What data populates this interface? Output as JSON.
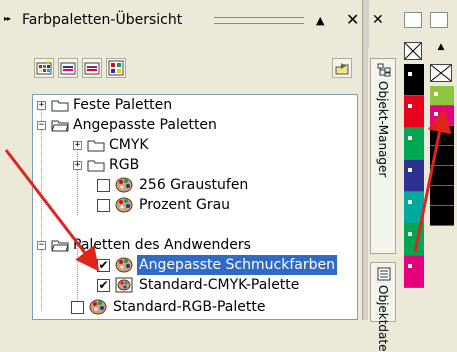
{
  "docker": {
    "title": "Farbpaletten-Übersicht",
    "collapse_symbol": "▸▸",
    "up_symbol": "▲",
    "close_symbol": "✕"
  },
  "toolbar": {
    "icons": [
      "new-palette-icon",
      "open-palette-icon",
      "palette-editor-icon",
      "palette-properties-icon",
      "import-icon"
    ]
  },
  "tree": {
    "items": [
      {
        "label": "Feste Paletten",
        "expander": "+",
        "icon": "folder-icon"
      },
      {
        "label": "Angepasste Paletten",
        "expander": "−",
        "icon": "folder-open-icon"
      },
      {
        "label": "CMYK",
        "expander": "+",
        "icon": "folder-icon"
      },
      {
        "label": "RGB",
        "expander": "+",
        "icon": "folder-icon"
      },
      {
        "label": "256 Graustufen",
        "checked": false,
        "icon": "palette-icon"
      },
      {
        "label": "Prozent Grau",
        "checked": false,
        "icon": "palette-icon"
      },
      {
        "label": "Paletten des Andwenders",
        "expander": "−",
        "icon": "folder-open-icon"
      },
      {
        "label": "Angepasste Schmuckfarben",
        "checked": true,
        "icon": "palette-icon",
        "selected": true
      },
      {
        "label": "Standard-CMYK-Palette",
        "checked": true,
        "icon": "palette-icon"
      },
      {
        "label": "Standard-RGB-Palette",
        "checked": false,
        "icon": "palette-icon"
      }
    ],
    "check_mark": "✔"
  },
  "side_tabs": {
    "close": "✕",
    "tab1": "Objekt-Manager",
    "tab2": "Objektdate"
  },
  "palette": {
    "col1": [
      "#000000",
      "#e8001c",
      "#00a651",
      "#2e3192",
      "#00a99d",
      "#00a651",
      "#e6007e"
    ],
    "col2": [
      "#8dc63f",
      "#e6007e",
      "#000000",
      "#000000",
      "#000000",
      "#000000",
      "#000000"
    ]
  },
  "colors": {
    "arrow": "#e0241b",
    "selection": "#316ac5"
  }
}
